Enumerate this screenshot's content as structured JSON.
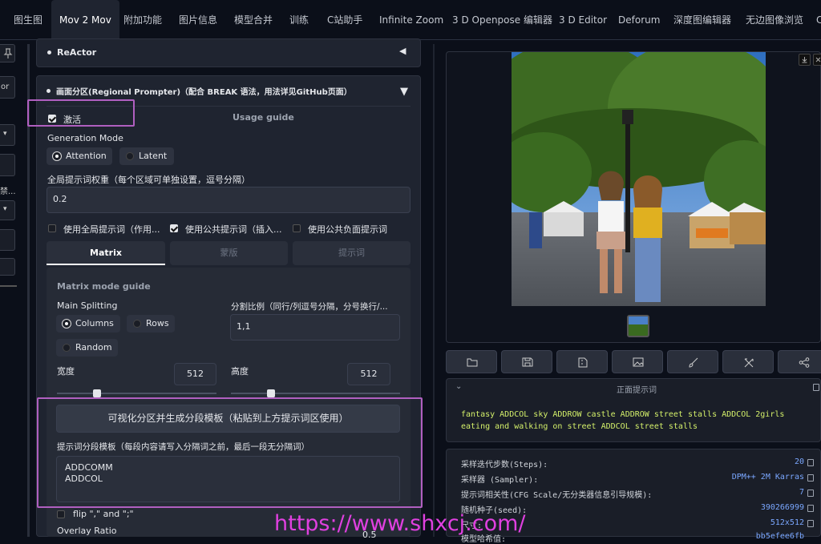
{
  "tabs": [
    "图生图",
    "Mov 2 Mov",
    "附加功能",
    "图片信息",
    "模型合并",
    "训练",
    "C站助手",
    "Infinite Zoom",
    "3 D Openpose 编辑器",
    "3 D Editor",
    "Deforum",
    "深度图编辑器",
    "无边图像浏览"
  ],
  "left_strip": {
    "text1": "or",
    "text2": "禁..."
  },
  "reactor": {
    "title": "ReActor",
    "toggle": "◀"
  },
  "regional": {
    "title": "画面分区(Regional Prompter)（配合 BREAK 语法，用法详见GitHub页面）",
    "toggle": "▼",
    "activate_label": "激活",
    "usage_guide": "Usage guide",
    "generation_mode_label": "Generation Mode",
    "modes": [
      "Attention",
      "Latent"
    ],
    "base_ratio_label": "全局提示词权重（每个区域可单独设置，逗号分隔）",
    "base_ratio_value": "0.2",
    "checkboxes": [
      {
        "label": "使用全局提示词（作用...",
        "checked": false
      },
      {
        "label": "使用公共提示词（插入...",
        "checked": true
      },
      {
        "label": "使用公共负面提示词",
        "checked": false
      }
    ],
    "subtabs": [
      "Matrix",
      "蒙版",
      "提示词"
    ],
    "matrix_guide": "Matrix mode guide",
    "main_splitting_label": "Main Splitting",
    "splits": [
      "Columns",
      "Rows",
      "Random"
    ],
    "divide_ratio_label": "分割比例（同行/列逗号分隔，分号换行/...",
    "divide_ratio_value": "1,1",
    "width_label": "宽度",
    "width_value": "512",
    "height_label": "高度",
    "height_value": "512",
    "visualize_button": "可视化分区并生成分段模板（粘贴到上方提示词区使用）",
    "template_label": "提示词分段模板（每段内容请写入分隔词之前，最后一段无分隔词）",
    "template_lines": [
      "ADDCOMM",
      "ADDCOL"
    ],
    "flip_label": "flip \",\" and \";\"",
    "overlay_label": "Overlay Ratio",
    "overlay_value": "0.5"
  },
  "output": {
    "prompt_header": "正面提示词",
    "prompt_text": "fantasy ADDCOL sky ADDROW castle ADDROW street stalls ADDCOL 2girls eating and walking on street ADDCOL street stalls",
    "info": [
      {
        "label": "采样迭代步数(Steps):",
        "value": "20"
      },
      {
        "label": "采样器 (Sampler):",
        "value": "DPM++ 2M Karras"
      },
      {
        "label": "提示词相关性(CFG Scale/无分类器信息引导规模):",
        "value": "7"
      },
      {
        "label": "随机种子(seed):",
        "value": "390266999"
      },
      {
        "label": "尺寸:",
        "value": "512x512"
      },
      {
        "label": "模型哈希值:",
        "value": "bb5efee6fb"
      }
    ]
  },
  "watermark": "https://www.shxcj.com/",
  "colors": {
    "highlight": "#b05fc0",
    "watermark": "#e040e0",
    "prompt_text": "#d4f06a",
    "value": "#7aa7ff"
  }
}
